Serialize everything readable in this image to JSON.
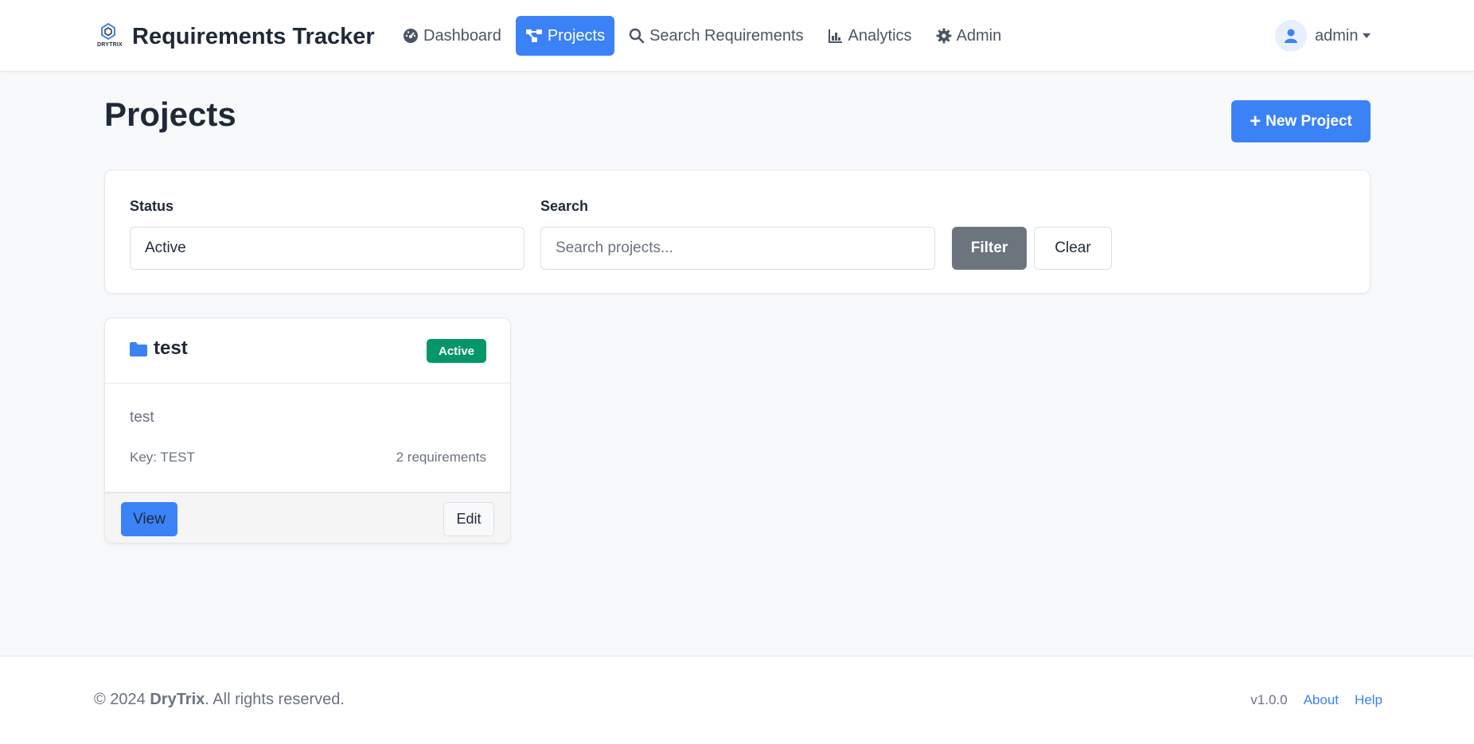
{
  "brand": {
    "logo_text": "DRYTRIX",
    "title": "Requirements Tracker"
  },
  "nav": {
    "items": [
      {
        "label": "Dashboard",
        "icon": "dashboard-gauge-icon",
        "active": false
      },
      {
        "label": "Projects",
        "icon": "project-diagram-icon",
        "active": true
      },
      {
        "label": "Search Requirements",
        "icon": "search-icon",
        "active": false
      },
      {
        "label": "Analytics",
        "icon": "chart-bar-icon",
        "active": false
      },
      {
        "label": "Admin",
        "icon": "gear-icon",
        "active": false
      }
    ]
  },
  "user": {
    "name": "admin",
    "icon": "user-icon"
  },
  "page": {
    "title": "Projects",
    "new_button_label": "New Project"
  },
  "filters": {
    "status_label": "Status",
    "status_value": "Active",
    "search_label": "Search",
    "search_placeholder": "Search projects...",
    "filter_button": "Filter",
    "clear_button": "Clear"
  },
  "projects": [
    {
      "name": "test",
      "status": "Active",
      "description": "test",
      "key": "Key: TEST",
      "requirements": "2 requirements",
      "view_label": "View",
      "edit_label": "Edit"
    }
  ],
  "footer": {
    "copyright_prefix": "© 2024 ",
    "company": "DryTrix",
    "copyright_suffix": ". All rights reserved.",
    "version": "v1.0.0",
    "about": "About",
    "help": "Help"
  },
  "colors": {
    "primary": "#3b82f6",
    "success": "#059669",
    "secondary": "#6c757d"
  }
}
